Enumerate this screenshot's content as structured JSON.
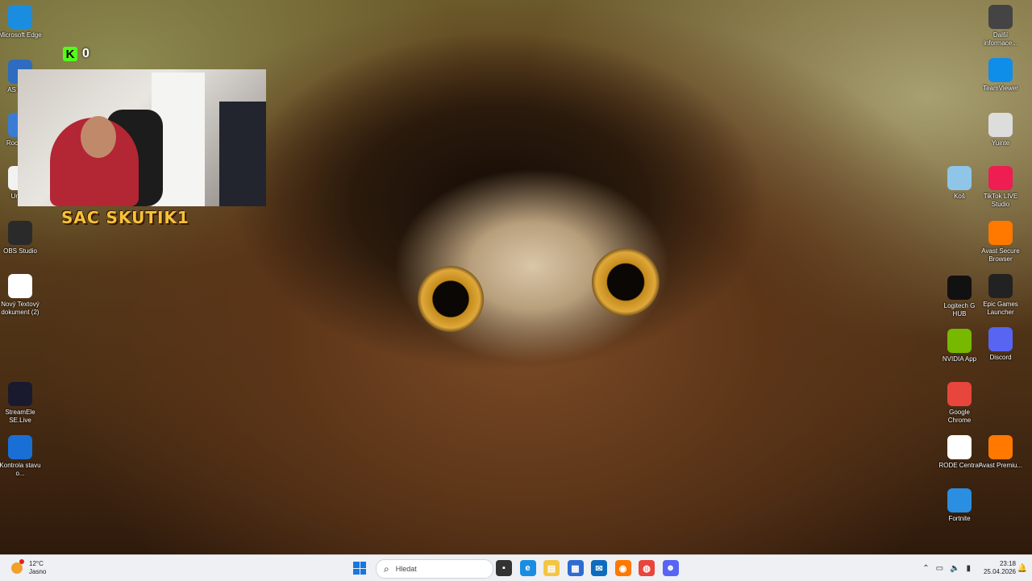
{
  "overlay": {
    "kick_count": "0",
    "streamer_name": "SAC SKUTIK1"
  },
  "desktop_left": [
    {
      "label": "Microsoft Edge",
      "icon": "edge-icon",
      "color": "#1b8de0"
    },
    {
      "label": "AS Drive",
      "icon": "drive-icon",
      "color": "#2d6cc0"
    },
    {
      "label": "Roc Leag",
      "icon": "game-icon",
      "color": "#3a7bd5"
    },
    {
      "label": "Unsav",
      "icon": "file-icon",
      "color": "#f2f2f2"
    },
    {
      "label": "OBS Studio",
      "icon": "obs-icon",
      "color": "#2a2a2a"
    },
    {
      "label": "Nový Textový dokument (2)",
      "icon": "text-document-icon",
      "color": "#ffffff"
    },
    {
      "label": "StreamEle SE.Live",
      "icon": "streamelements-icon",
      "color": "#1a1a2e"
    },
    {
      "label": "Kontrola stavu o...",
      "icon": "health-check-icon",
      "color": "#1a6fd6"
    }
  ],
  "desktop_right_col1": [
    {
      "label": "Koš",
      "icon": "recycle-bin-icon",
      "color": "#8fc6e8"
    },
    {
      "label": "Logitech G HUB",
      "icon": "logitech-icon",
      "color": "#111111"
    },
    {
      "label": "NVIDIA App",
      "icon": "nvidia-icon",
      "color": "#76b900"
    },
    {
      "label": "Google Chrome",
      "icon": "chrome-icon",
      "color": "#e8453c"
    },
    {
      "label": "RODE Central",
      "icon": "rode-icon",
      "color": "#ffffff"
    },
    {
      "label": "Fortnite",
      "icon": "fortnite-icon",
      "color": "#2a8fe0"
    }
  ],
  "desktop_right_col2": [
    {
      "label": "Další informace...",
      "icon": "info-icon",
      "color": "#444444"
    },
    {
      "label": "TeamViewer",
      "icon": "teamviewer-icon",
      "color": "#0e8ee9"
    },
    {
      "label": "Yuinte",
      "icon": "yuinte-icon",
      "color": "#dddddd"
    },
    {
      "label": "TikTok LIVE Studio",
      "icon": "tiktok-icon",
      "color": "#ee1d52"
    },
    {
      "label": "Avast Secure Browser",
      "icon": "avast-browser-icon",
      "color": "#ff7800"
    },
    {
      "label": "Epic Games Launcher",
      "icon": "epic-icon",
      "color": "#222222"
    },
    {
      "label": "Discord",
      "icon": "discord-icon",
      "color": "#5865f2"
    },
    {
      "label": "Avast Premiu...",
      "icon": "avast-icon",
      "color": "#ff7800"
    }
  ],
  "taskbar": {
    "weather_temp": "12°C",
    "weather_desc": "Jasno",
    "search_placeholder": "Hledat",
    "apps": [
      {
        "name": "task-view-icon",
        "color": "#333333",
        "glyph": "▪"
      },
      {
        "name": "edge-icon",
        "color": "#1b8de0",
        "glyph": "e"
      },
      {
        "name": "file-explorer-icon",
        "color": "#f5c542",
        "glyph": "▤"
      },
      {
        "name": "store-icon",
        "color": "#2f6bd0",
        "glyph": "▦"
      },
      {
        "name": "outlook-icon",
        "color": "#0f6cbd",
        "glyph": "✉"
      },
      {
        "name": "avast-browser-icon",
        "color": "#ff7800",
        "glyph": "◉"
      },
      {
        "name": "chrome-icon",
        "color": "#e8453c",
        "glyph": "◍"
      },
      {
        "name": "discord-icon",
        "color": "#5865f2",
        "glyph": "☻"
      }
    ],
    "time": "23:18",
    "date": "25.04.2026"
  }
}
